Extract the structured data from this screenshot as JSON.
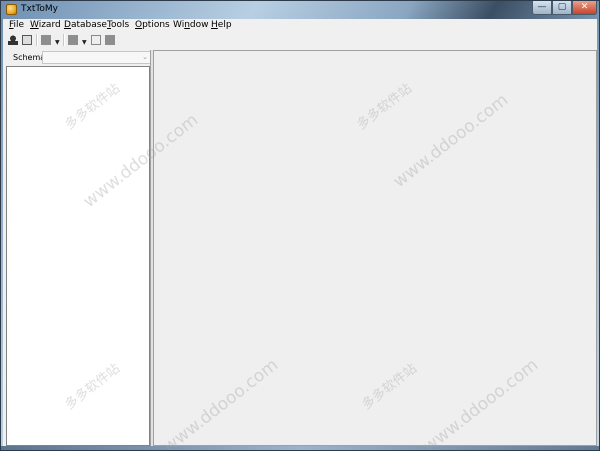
{
  "window": {
    "title": "TxtToMy",
    "buttons": {
      "minimize": "—",
      "maximize": "▢",
      "close": "✕"
    }
  },
  "menubar": {
    "items": [
      {
        "label": "File",
        "accel": "F",
        "rest": "ile"
      },
      {
        "label": "Wizard",
        "accel": "W",
        "rest": "izard"
      },
      {
        "label": "Database",
        "accel": "D",
        "rest": "atabase"
      },
      {
        "label": "Tools",
        "accel": "T",
        "rest": "ools"
      },
      {
        "label": "Options",
        "accel": "O",
        "rest": "ptions"
      },
      {
        "label": "Window",
        "pre": "Wi",
        "accel": "n",
        "rest": "dow"
      },
      {
        "label": "Help",
        "accel": "H",
        "rest": "elp"
      }
    ]
  },
  "toolbar": {
    "icons": [
      "connect-icon",
      "new-document-icon",
      "gray-square-icon",
      "dropdown-arrow-icon",
      "gray-square-icon",
      "dropdown-arrow-icon",
      "window-icon",
      "gray-square-icon"
    ],
    "dropdown_glyph": "▼"
  },
  "schema": {
    "label": "Schema",
    "selected": "",
    "arrow": "⌄"
  },
  "watermark": {
    "site": "www.ddooo.com",
    "chinese": "多多软件站"
  }
}
